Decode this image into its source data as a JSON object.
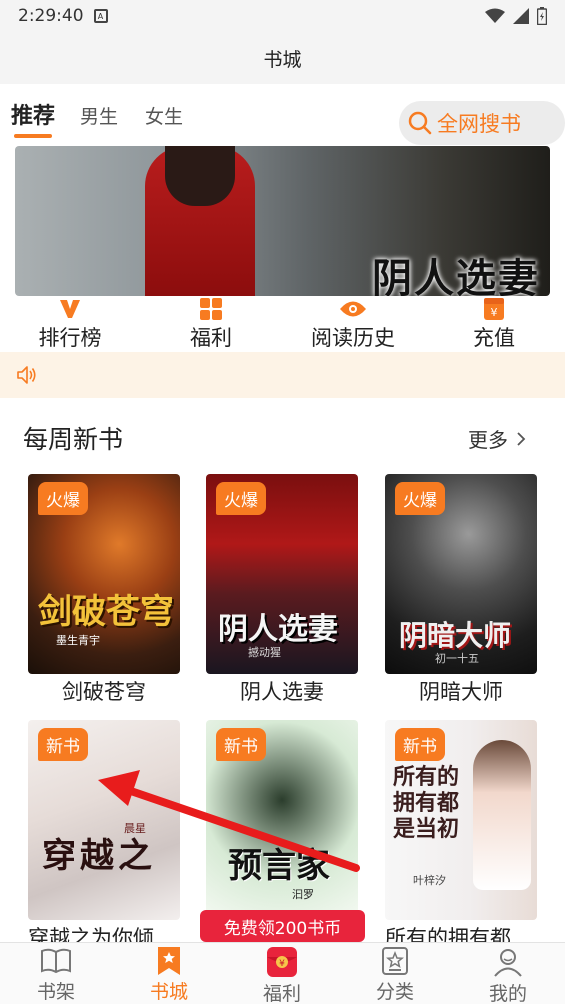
{
  "status_bar": {
    "time": "2:29:40"
  },
  "header": {
    "title": "书城"
  },
  "tabs": [
    {
      "label": "推荐",
      "active": true
    },
    {
      "label": "男生",
      "active": false
    },
    {
      "label": "女生",
      "active": false
    }
  ],
  "search": {
    "label": "全网搜书"
  },
  "banner": {
    "art_text": "阴人选妻"
  },
  "quick_nav": [
    {
      "label": "排行榜",
      "icon": "rank-v-icon"
    },
    {
      "label": "福利",
      "icon": "grid-icon"
    },
    {
      "label": "阅读历史",
      "icon": "eye-icon"
    },
    {
      "label": "充值",
      "icon": "yuan-icon"
    }
  ],
  "section": {
    "title": "每周新书",
    "more": "更多"
  },
  "books": [
    {
      "title": "剑破苍穹",
      "badge": "火爆",
      "cover_text": "剑破苍穹",
      "author": "墨生青宇"
    },
    {
      "title": "阴人选妻",
      "badge": "火爆",
      "cover_text": "阴人选妻",
      "author": "撼动猩"
    },
    {
      "title": "阴暗大师",
      "badge": "火爆",
      "cover_text": "阴暗大师",
      "author": "初一十五"
    },
    {
      "title": "穿越之为你倾",
      "badge": "新书",
      "cover_text": "穿越之",
      "author": "晨星"
    },
    {
      "title": "预言家",
      "badge": "新书",
      "cover_text": "预言家",
      "author": "汩罗"
    },
    {
      "title": "所有的拥有都",
      "badge": "新书",
      "cover_text": "所有的拥有都是当初",
      "author": "叶梓汐"
    }
  ],
  "promo": {
    "label": "免费领200书币"
  },
  "bottom_nav": [
    {
      "label": "书架",
      "active": false
    },
    {
      "label": "书城",
      "active": true
    },
    {
      "label": "福利",
      "active": false
    },
    {
      "label": "分类",
      "active": false
    },
    {
      "label": "我的",
      "active": false
    }
  ],
  "colors": {
    "accent": "#f77b21",
    "promo_red": "#e8243c",
    "notice_bg": "#fdf3e6"
  }
}
